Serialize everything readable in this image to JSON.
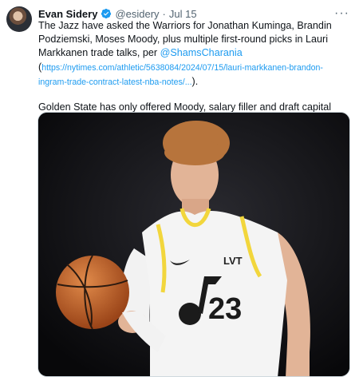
{
  "tweet": {
    "author_name": "Evan Sidery",
    "handle": "@esidery",
    "separator": "·",
    "date": "Jul 15",
    "more_label": "···",
    "body_part1": "The Jazz have asked the Warriors for Jonathan Kuminga, Brandin Podziemski, Moses Moody, plus multiple first-round picks in Lauri Markkanen trade talks, per ",
    "mention": "@ShamsCharania",
    "paren_open": "(",
    "url": "https://nytimes.com/athletic/5638084/2024/07/15/lauri-markkanen-brandon-ingram-trade-contract-latest-nba-notes/...",
    "paren_close": ").",
    "body_part2": "Golden State has only offered Moody, salary filler and draft capital thus far."
  },
  "media": {
    "jersey_brand": "LVT",
    "jersey_number": "23"
  },
  "colors": {
    "link": "#1d9bf0",
    "jersey_accent": "#f2d63c",
    "ball": "#c8642a"
  },
  "icons": [
    "avatar",
    "verified-badge-icon",
    "more-options-icon",
    "nike-swoosh-icon",
    "jazz-note-logo-icon",
    "basketball-icon"
  ]
}
